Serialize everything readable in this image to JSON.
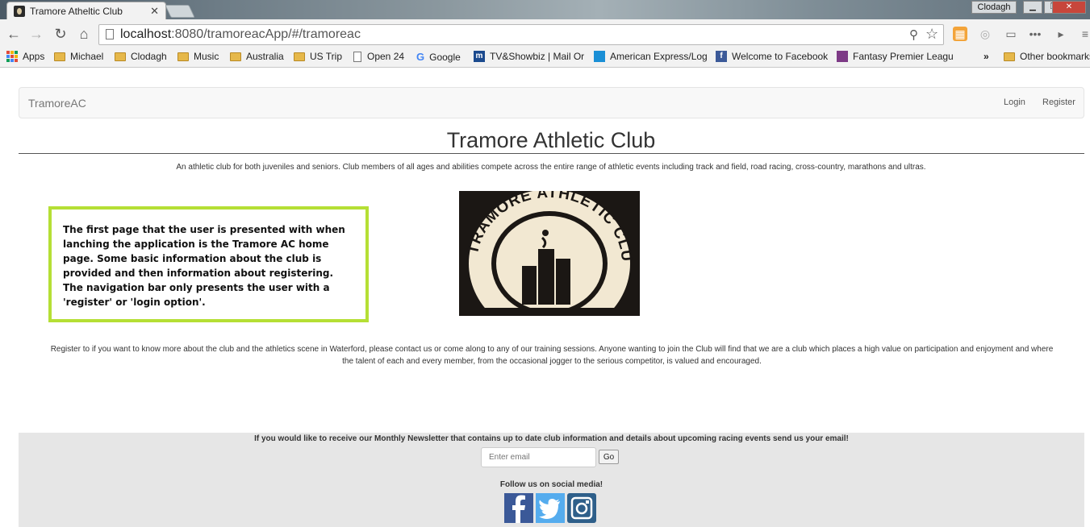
{
  "browser": {
    "tab_title": "Tramore Atheltic Club",
    "tab_close": "✕",
    "profile_name": "Clodagh",
    "url_host": "localhost",
    "url_rest": ":8080/tramoreacApp/#/tramoreac",
    "bookmarks": [
      "Apps",
      "Michael",
      "Clodagh",
      "Music",
      "Australia",
      "US Trip",
      "Open 24",
      "Google",
      "TV&Showbiz | Mail Or",
      "American Express/Log",
      "Welcome to Facebook",
      "Fantasy Premier Leagu",
      "»",
      "Other bookmarks"
    ]
  },
  "navbar": {
    "brand": "TramoreAC",
    "login": "Login",
    "register": "Register"
  },
  "main": {
    "title": "Tramore Athletic Club",
    "intro": "An athletic club for both juveniles and seniors. Club members of all ages and abilities compete across the entire range of athletic events including track and field, road racing, cross-country, marathons and ultras.",
    "logo_text": "TRAMORE ATHLETIC CLUB",
    "register_line1": "Register to if you want to know more about the club and the athletics scene in Waterford, please contact us or come along to any of our training sessions. Anyone wanting to join the Club will find that we are a club which places a high value on participation and enjoyment and where",
    "register_line2": "the talent of each and every member, from the occasional jogger to the serious competitor, is valued and encouraged."
  },
  "annotation": {
    "text": "The first page that the user is presented with when lanching the application is the Tramore AC home page. Some basic information about the club is provided and then information about registering. The navigation bar only presents the user with a 'register' or 'login option'."
  },
  "footer": {
    "newsletter_text": "If you would like to receive our Monthly Newsletter that contains up to date club information and details about upcoming racing events send us your email!",
    "email_placeholder": "Enter email",
    "go_label": "Go",
    "follow_text": "Follow us on social media!"
  },
  "colors": {
    "annotation_border": "#b5df35",
    "facebook": "#3b5998",
    "twitter": "#55acee",
    "instagram": "#2e5f8a"
  }
}
